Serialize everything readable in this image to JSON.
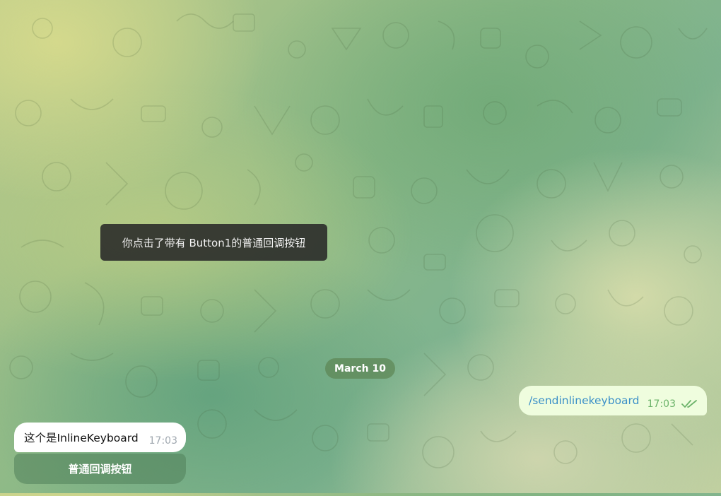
{
  "callback_toast": {
    "text": "你点击了带有 Button1的普通回调按钮"
  },
  "date_separator": {
    "label": "March 10"
  },
  "outgoing_message": {
    "text": "/sendinlinekeyboard",
    "time": "17:03",
    "status_icon": "double-check-icon",
    "colors": {
      "bubble": "#effdde",
      "link": "#3a8fc8",
      "meta": "#6cb36a"
    }
  },
  "incoming_message": {
    "text": "这个是InlineKeyboard",
    "time": "17:03",
    "inline_keyboard": [
      {
        "label": "普通回调按钮"
      }
    ]
  }
}
